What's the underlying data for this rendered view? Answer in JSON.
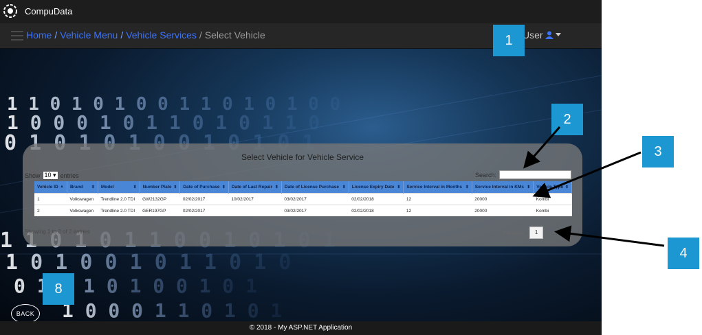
{
  "app": {
    "brand": "CompuData",
    "user_label": "User"
  },
  "breadcrumb": {
    "home": "Home",
    "vehicle_menu": "Vehicle Menu",
    "vehicle_services": "Vehicle Services",
    "current": "Select Vehicle",
    "separator": "/"
  },
  "panel": {
    "title": "Select Vehicle for Vehicle Service",
    "show_label": "Show",
    "entries_value": "10",
    "entries_label": "entries",
    "search_label": "Search:",
    "search_value": "",
    "info": "Showing 1 to 2 of 2 entries",
    "prev_label": "Previous",
    "page_number": "1"
  },
  "table": {
    "headers": [
      "Vehicle ID",
      "Brand",
      "Model",
      "Number Plate",
      "Date of Purchase",
      "Date of Last Repair",
      "Date of License Purchase",
      "License Expiry Date",
      "Service Interval in Months",
      "Service Interval in KMs",
      "Vehicle Type"
    ],
    "rows": [
      [
        "1",
        "Volkswagen",
        "Trendline 2.0 TDI",
        "GW2132GP",
        "02/02/2017",
        "10/02/2017",
        "03/02/2017",
        "02/02/2018",
        "12",
        "20000",
        "Kombi"
      ],
      [
        "2",
        "Volkswagen",
        "Trendline 2.0 TDI",
        "GER197GP",
        "02/02/2017",
        "",
        "03/02/2017",
        "02/02/2018",
        "12",
        "20000",
        "Kombi"
      ]
    ]
  },
  "back_label": "BACK",
  "footer": "© 2018 - My ASP.NET Application",
  "annotations": [
    "1",
    "2",
    "3",
    "4",
    "8"
  ],
  "colors": {
    "accent": "#1c97d2",
    "link": "#3a73ff",
    "table_header": "#4a86d6"
  }
}
